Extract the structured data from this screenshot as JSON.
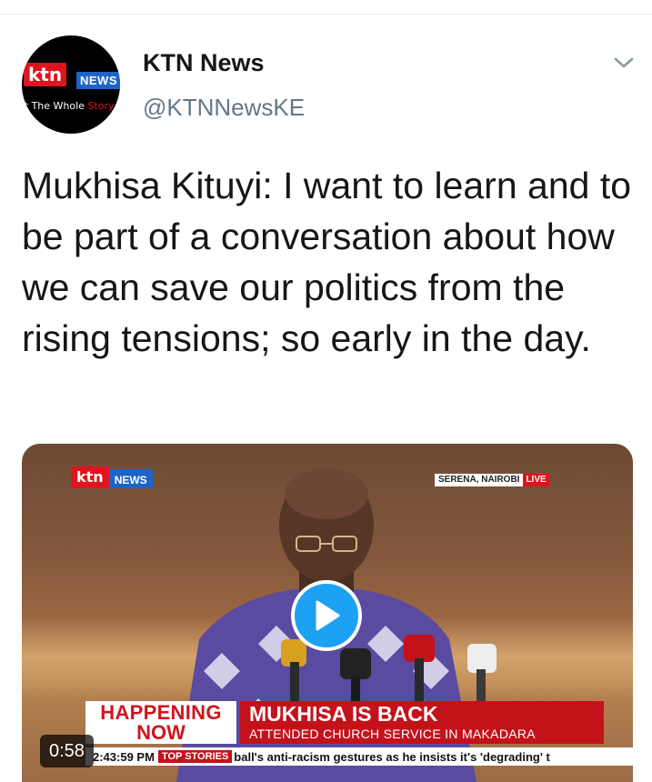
{
  "tweet": {
    "author": {
      "display_name": "KTN News",
      "handle": "@KTNNewsKE",
      "avatar": {
        "brand": "ktn",
        "brand_suffix": "NEWS",
        "tagline_prefix": "et The Whole ",
        "tagline_highlight": "Story"
      }
    },
    "menu_icon": "chevron-down-icon",
    "text": "Mukhisa Kituyi: I want to learn and to be part of a conversation about how we can save our politics from the rising tensions; so early in the day.",
    "media": {
      "type": "video",
      "duration": "0:58",
      "overlay": {
        "logo_ktn": "ktn",
        "logo_news": "NEWS",
        "location": "SERENA, NAIROBI",
        "live_label": "LIVE",
        "headline_left_1": "HAPPENING",
        "headline_left_2": "NOW",
        "headline_title": "MUKHISA IS BACK",
        "headline_sub": "ATTENDED CHURCH SERVICE IN MAKADARA",
        "ticker_time": "2:43:59 PM",
        "ticker_badge": "TOP STORIES",
        "ticker_text": "ball's anti-racism gestures as he insists it's 'degrading' t"
      }
    }
  },
  "colors": {
    "play_button": "#1da1f2",
    "ktn_red": "#e0141e",
    "ktn_blue": "#1e64c8",
    "text_primary": "#14171a",
    "text_secondary": "#657786"
  }
}
